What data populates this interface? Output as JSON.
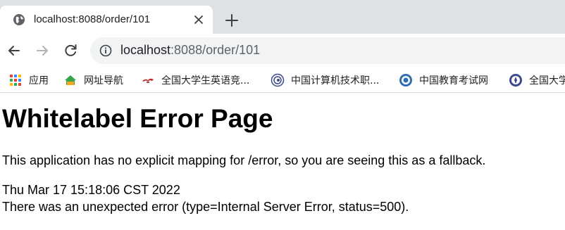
{
  "browser": {
    "tab": {
      "title": "localhost:8088/order/101",
      "favicon": "globe-icon"
    },
    "omnibox": {
      "host": "localhost",
      "path": ":8088/order/101"
    },
    "bookmarks": [
      {
        "label": "应用",
        "icon": "apps-grid-icon"
      },
      {
        "label": "网址导航",
        "icon": "house-2345-icon"
      },
      {
        "label": "全国大学生英语竞...",
        "icon": "red-logo-icon"
      },
      {
        "label": "中国计算机技术职...",
        "icon": "round-seal-icon"
      },
      {
        "label": "中国教育考试网",
        "icon": "blue-emblem-icon"
      },
      {
        "label": "全国大学",
        "icon": "blue-emblem-icon"
      }
    ]
  },
  "page": {
    "heading": "Whitelabel Error Page",
    "message": "This application has no explicit mapping for /error, so you are seeing this as a fallback.",
    "timestamp": "Thu Mar 17 15:18:06 CST 2022",
    "error_detail": "There was an unexpected error (type=Internal Server Error, status=500)."
  }
}
